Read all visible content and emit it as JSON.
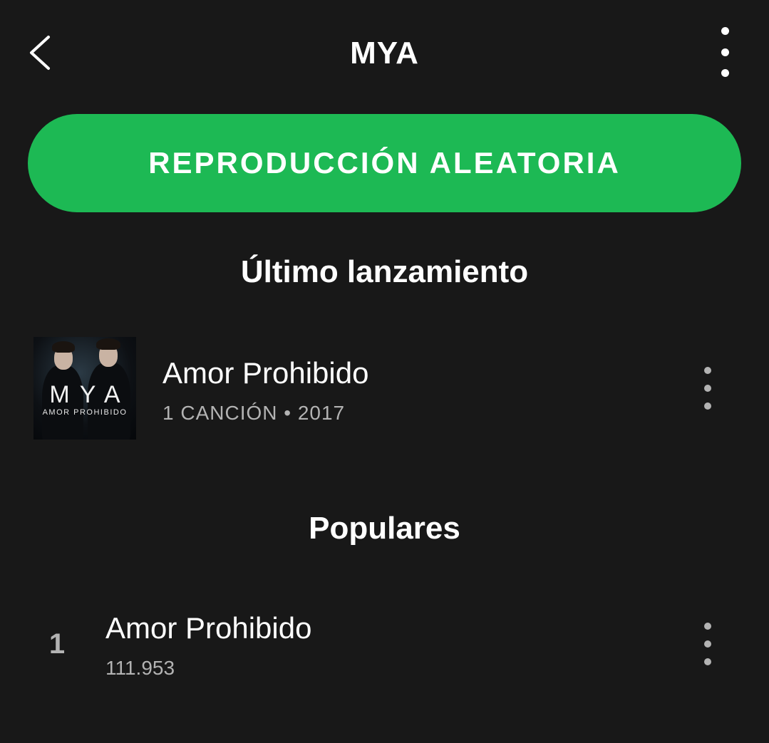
{
  "header": {
    "title": "MYA",
    "back_icon": "chevron-left-icon",
    "more_icon": "more-vertical-icon"
  },
  "shuffle_button": {
    "label": "REPRODUCCIÓN ALEATORIA",
    "color": "#1db954"
  },
  "latest_release": {
    "section_title": "Último lanzamiento",
    "cover": {
      "logo_text": "MYA",
      "subtitle_text": "AMOR PROHIBIDO"
    },
    "title": "Amor Prohibido",
    "meta": "1 CANCIÓN • 2017"
  },
  "popular": {
    "section_title": "Populares",
    "tracks": [
      {
        "index": "1",
        "title": "Amor Prohibido",
        "plays": "111.953"
      }
    ]
  },
  "colors": {
    "background": "#181818",
    "text_primary": "#ffffff",
    "text_secondary": "#b3b3b3",
    "accent": "#1db954"
  }
}
